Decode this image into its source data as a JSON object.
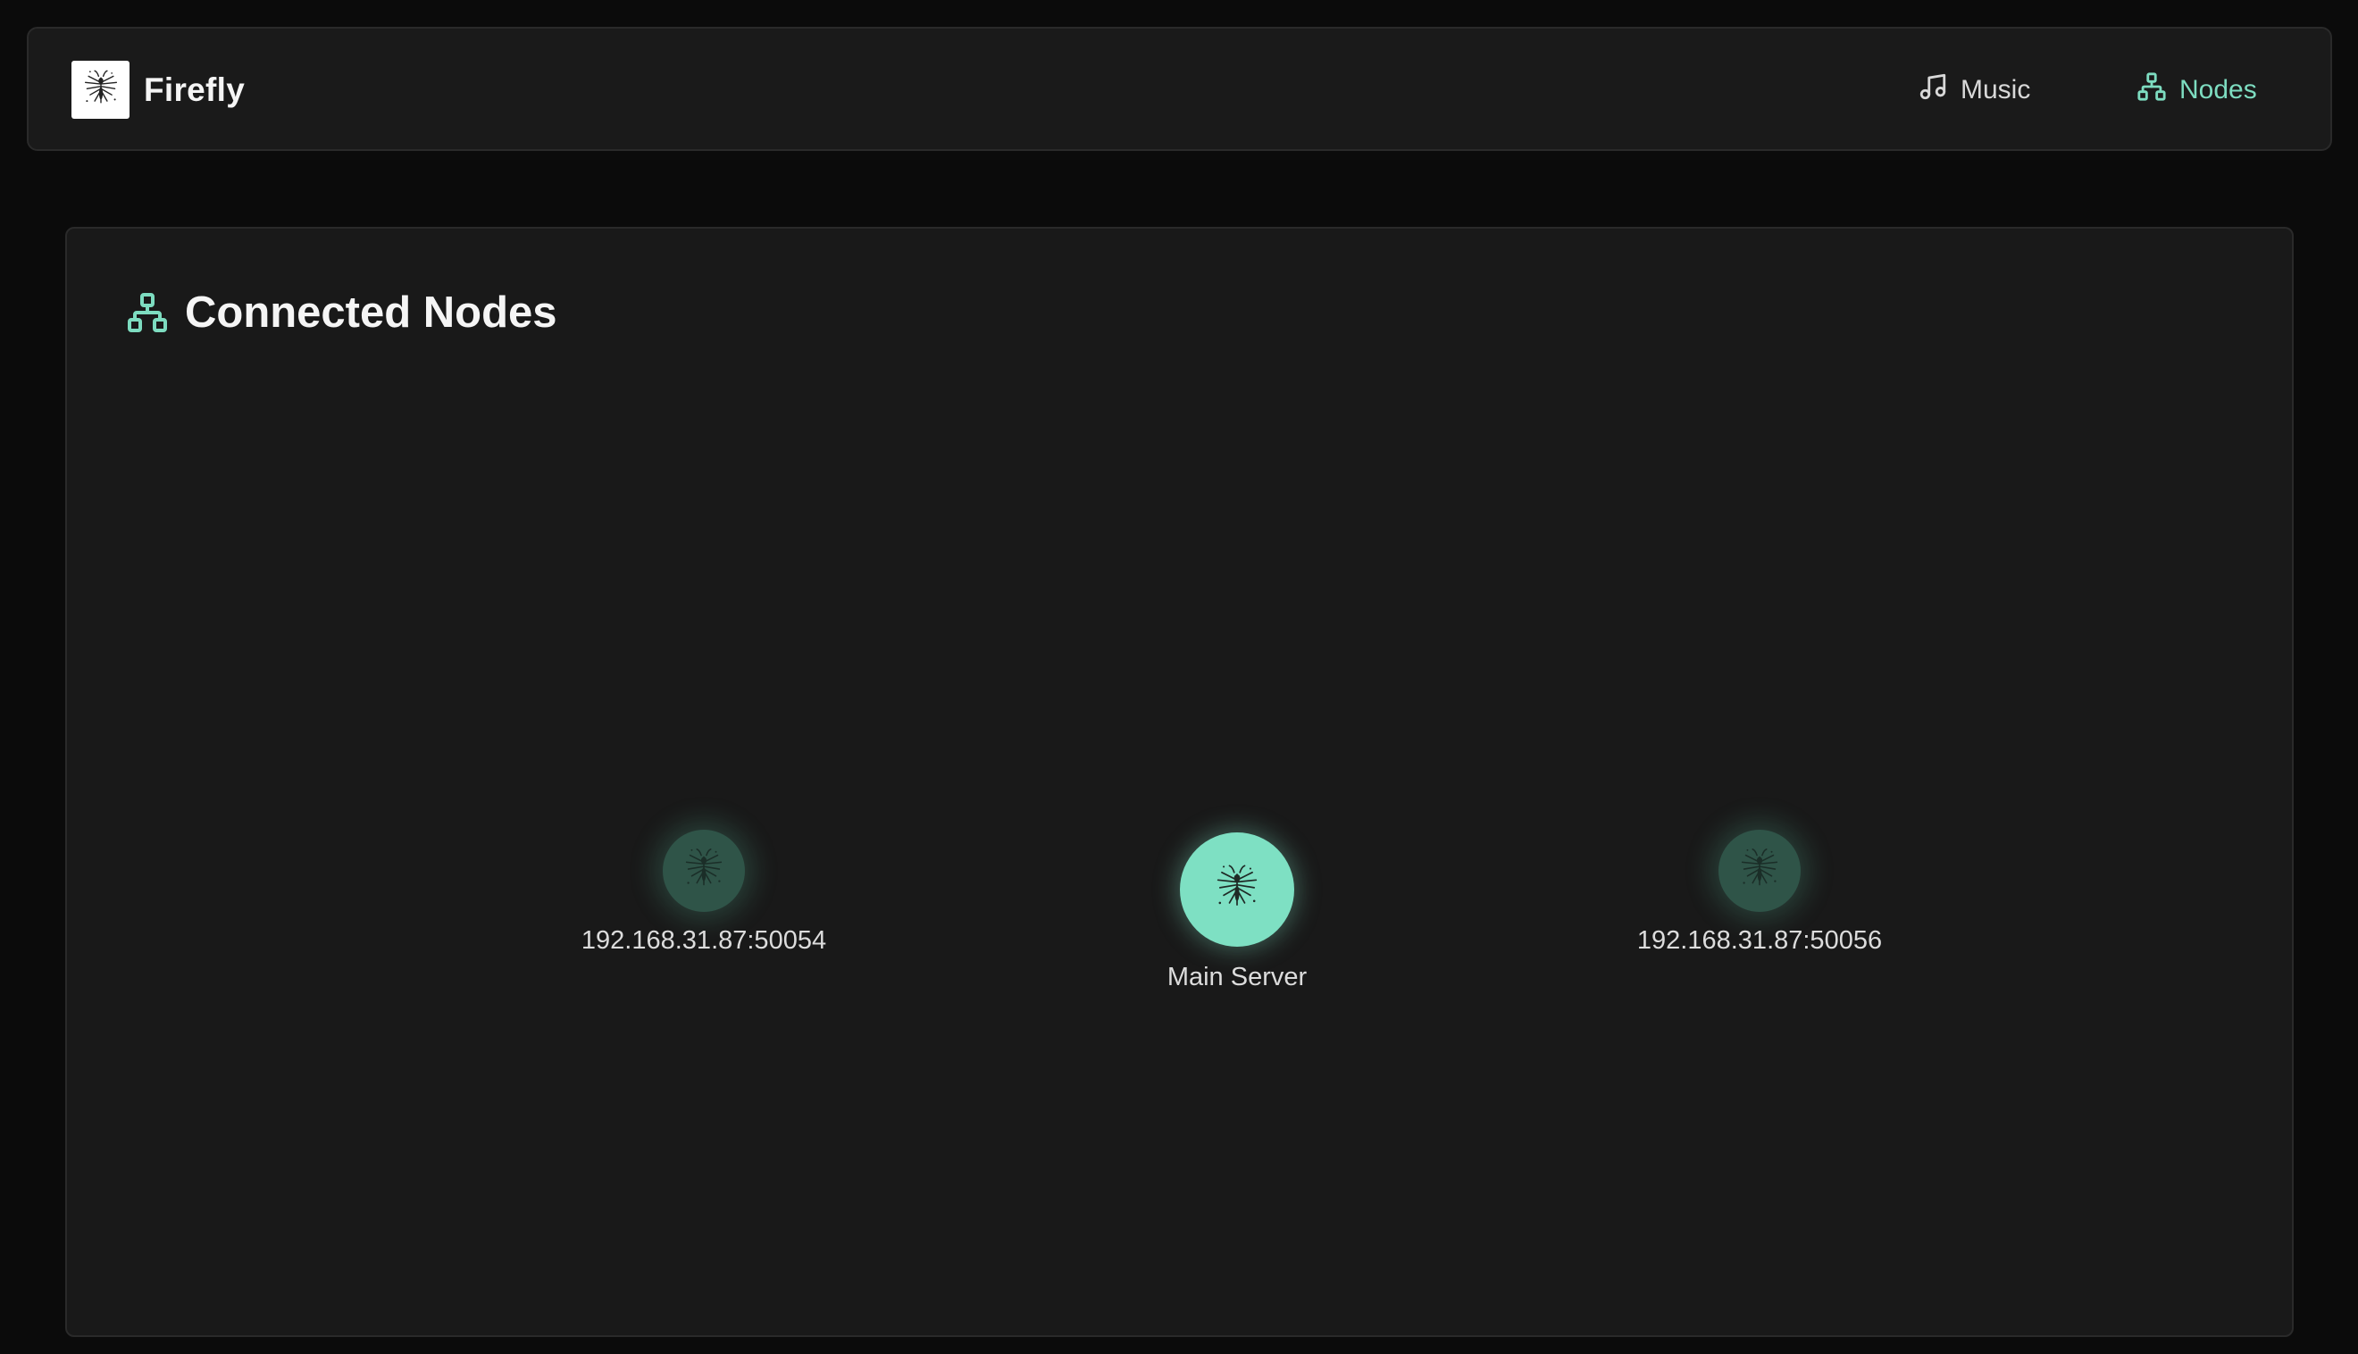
{
  "app": {
    "name": "Firefly"
  },
  "nav": {
    "items": [
      {
        "label": "Music",
        "icon": "music-note-icon",
        "active": false
      },
      {
        "label": "Nodes",
        "icon": "network-icon",
        "active": true
      }
    ]
  },
  "panel": {
    "title": "Connected Nodes",
    "icon": "network-icon"
  },
  "nodes": [
    {
      "label": "192.168.31.87:50054",
      "role": "peer"
    },
    {
      "label": "Main Server",
      "role": "main"
    },
    {
      "label": "192.168.31.87:50056",
      "role": "peer"
    }
  ],
  "colors": {
    "accent": "#7ee0c3",
    "peer_node": "#2f5448",
    "background": "#0b0b0b",
    "surface": "#1a1a1a"
  }
}
